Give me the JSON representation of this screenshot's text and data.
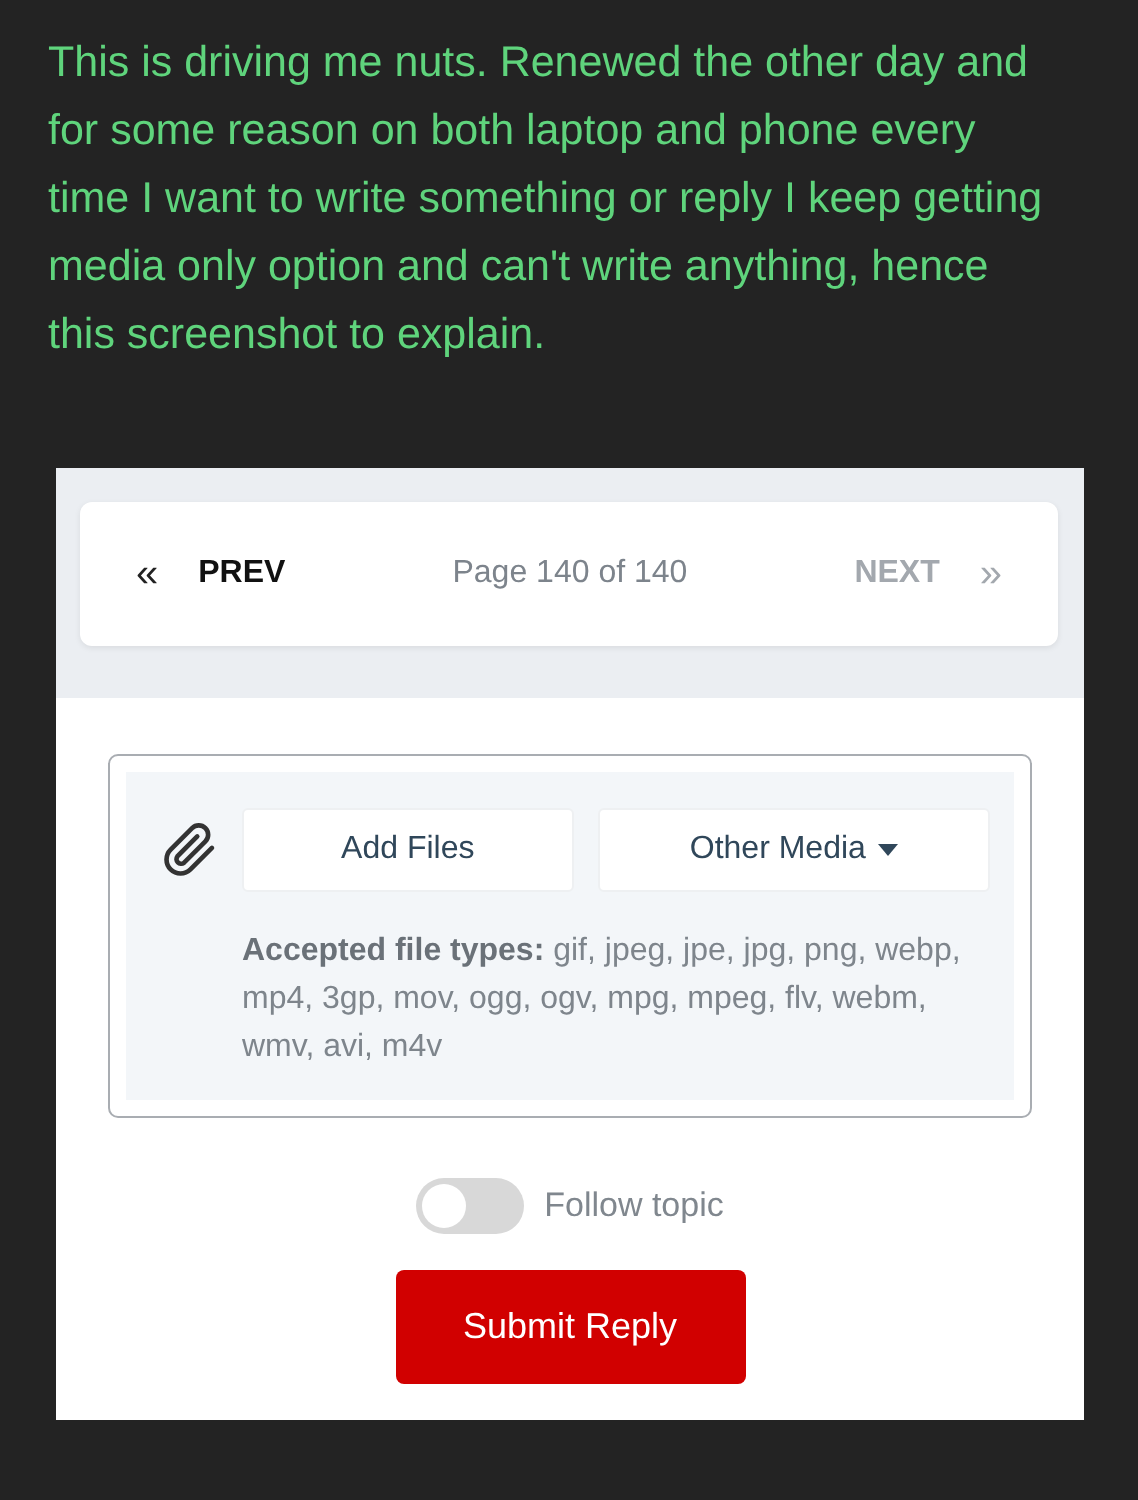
{
  "post": {
    "text": "This is driving me nuts. Renewed the other day and for some reason on both laptop and phone every time I want to write something or reply I keep getting media only option and can't write anything, hence this screenshot to explain."
  },
  "pagination": {
    "prev": {
      "icon": "«",
      "label": "PREV",
      "disabled": false
    },
    "page_info": "Page 140 of 140",
    "next": {
      "label": "NEXT",
      "icon": "»",
      "disabled": true
    }
  },
  "upload": {
    "buttons": [
      {
        "label": "Add Files",
        "dropdown": false
      },
      {
        "label": "Other Media",
        "dropdown": true
      }
    ],
    "accepted": "**Accepted file types:** gif, jpeg, jpe, jpg, png, webp, mp4, 3gp, mov, ogg, ogv, mpg, mpeg, flv, webm, wmv, avi, m4v"
  },
  "follow": {
    "label": "Follow topic",
    "on": false
  },
  "submit": {
    "label": "Submit Reply"
  }
}
